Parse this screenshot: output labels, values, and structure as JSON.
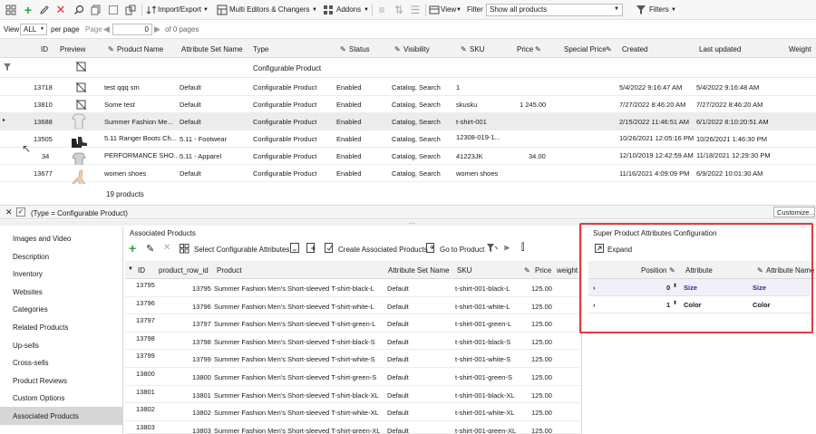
{
  "toolbar": {
    "import_export": "Import/Export",
    "multi_editors": "Multi Editors & Changers",
    "addons": "Addons",
    "view": "View",
    "filter_label": "Filter",
    "filter_value": "Show all products",
    "filters": "Filters"
  },
  "pager": {
    "view_label": "View",
    "view_value": "ALL",
    "per_page": "per page",
    "page_label": "Page",
    "page_value": "0",
    "of_pages": "of 0 pages"
  },
  "grid": {
    "headers": [
      "ID",
      "Preview",
      "Product Name",
      "Attribute Set Name",
      "Type",
      "Status",
      "Visibility",
      "SKU",
      "Price",
      "Special Price",
      "Created",
      "Last updated",
      "Weight"
    ],
    "filter_type": "Configurable Product",
    "rows": [
      {
        "id": "13718",
        "name": "test qqq sm",
        "set": "Default",
        "type": "Configurable Product",
        "status": "Enabled",
        "visibility": "Catalog, Search",
        "sku": "1",
        "price": "",
        "created": "5/4/2022 9:16:47 AM",
        "updated": "5/4/2022 9:16:48 AM"
      },
      {
        "id": "13810",
        "name": "Some test",
        "set": "Default",
        "type": "Configurable Product",
        "status": "Enabled",
        "visibility": "Catalog, Search",
        "sku": "skusku",
        "price": "1 245.00",
        "created": "7/27/2022 8:46:20 AM",
        "updated": "7/27/2022 8:46:20 AM"
      },
      {
        "id": "13688",
        "name": "Summer Fashion Me...",
        "set": "Default",
        "type": "Configurable Product",
        "status": "Enabled",
        "visibility": "Catalog, Search",
        "sku": "t-shirt-001",
        "price": "",
        "created": "2/15/2022 11:46:51 AM",
        "updated": "6/1/2022 8:10:20:51 AM"
      },
      {
        "id": "13505",
        "name": "5.11 Ranger Boots Ch...",
        "set": "5.11 - Footwear",
        "type": "Configurable Product",
        "status": "Enabled",
        "visibility": "Catalog, Search",
        "sku": "12308-019-1...",
        "price": "",
        "created": "10/26/2021 12:05:16 PM",
        "updated": "10/26/2021 1:46:30 PM"
      },
      {
        "id": "34",
        "name": "PERFORMANCE SHO...",
        "set": "5.11 - Apparel",
        "type": "Configurable Product",
        "status": "Enabled",
        "visibility": "Catalog, Search",
        "sku": "41223JK",
        "price": "34.00",
        "created": "12/10/2019 12:42:59 AM",
        "updated": "11/18/2021 12:29:30 PM"
      },
      {
        "id": "13677",
        "name": "women shoes",
        "set": "Default",
        "type": "Configurable Product",
        "status": "Enabled",
        "visibility": "Catalog, Search",
        "sku": "women shoes",
        "price": "",
        "created": "11/16/2021 4:09:09 PM",
        "updated": "6/9/2022 10:01:30 AM"
      }
    ],
    "summary": "19 products"
  },
  "filterbar": {
    "expression": "(Type = Configurable Product)",
    "customize": "Customize..."
  },
  "left_nav": [
    {
      "label": "Images and Video",
      "active": false
    },
    {
      "label": "Description",
      "active": false
    },
    {
      "label": "Inventory",
      "active": false
    },
    {
      "label": "Websites",
      "active": false
    },
    {
      "label": "Categories",
      "active": false
    },
    {
      "label": "Related Products",
      "active": false
    },
    {
      "label": "Up-sells",
      "active": false
    },
    {
      "label": "Cross-sells",
      "active": false
    },
    {
      "label": "Product Reviews",
      "active": false
    },
    {
      "label": "Custom Options",
      "active": false
    },
    {
      "label": "Associated Products",
      "active": true
    }
  ],
  "associated": {
    "title": "Associated Products",
    "select_attrs": "Select Configurable Attributes",
    "create_assoc": "Create Associated Products",
    "go_to_product": "Go to Product",
    "headers": [
      "ID",
      "product_row_id",
      "Product",
      "Attribute Set Name",
      "SKU",
      "Price",
      "weight"
    ],
    "rows": [
      {
        "id": "13795",
        "row_id": "13795",
        "product": "Summer Fashion Men's Short-sleeved T-shirt-black-L",
        "set": "Default",
        "sku": "t-shirt-001-black-L",
        "price": "125.00"
      },
      {
        "id": "13796",
        "row_id": "13796",
        "product": "Summer Fashion Men's Short-sleeved T-shirt-white-L",
        "set": "Default",
        "sku": "t-shirt-001-white-L",
        "price": "125.00"
      },
      {
        "id": "13797",
        "row_id": "13797",
        "product": "Summer Fashion Men's Short-sleeved T-shirt-green-L",
        "set": "Default",
        "sku": "t-shirt-001-green-L",
        "price": "125.00"
      },
      {
        "id": "13798",
        "row_id": "13798",
        "product": "Summer Fashion Men's Short-sleeved T-shirt-black-S",
        "set": "Default",
        "sku": "t-shirt-001-black-S",
        "price": "125.00"
      },
      {
        "id": "13799",
        "row_id": "13799",
        "product": "Summer Fashion Men's Short-sleeved T-shirt-white-S",
        "set": "Default",
        "sku": "t-shirt-001-white-S",
        "price": "125.00"
      },
      {
        "id": "13800",
        "row_id": "13800",
        "product": "Summer Fashion Men's Short-sleeved T-shirt-green-S",
        "set": "Default",
        "sku": "t-shirt-001-green-S",
        "price": "125.00"
      },
      {
        "id": "13801",
        "row_id": "13801",
        "product": "Summer Fashion Men's Short-sleeved T-shirt-black-XL",
        "set": "Default",
        "sku": "t-shirt-001-black-XL",
        "price": "125.00"
      },
      {
        "id": "13802",
        "row_id": "13802",
        "product": "Summer Fashion Men's Short-sleeved T-shirt-white-XL",
        "set": "Default",
        "sku": "t-shirt-001-white-XL",
        "price": "125.00"
      },
      {
        "id": "13803",
        "row_id": "13803",
        "product": "Summer Fashion Men's Short-sleeved T-shirt-green-XL",
        "set": "Default",
        "sku": "t-shirt-001-green-XL",
        "price": "125.00"
      }
    ]
  },
  "super_attrs": {
    "title": "Super Product Attributes Configuration",
    "expand": "Expand",
    "headers": [
      "Position",
      "Attribute",
      "Attribute Name"
    ],
    "rows": [
      {
        "position": "0",
        "attribute": "Size",
        "name": "Size"
      },
      {
        "position": "1",
        "attribute": "Color",
        "name": "Color"
      }
    ]
  },
  "colors": {
    "highlight_border": "#e0393e",
    "add_green": "#2e9e3e",
    "delete_red": "#d9363e",
    "link_blue": "#2b2b9e"
  }
}
